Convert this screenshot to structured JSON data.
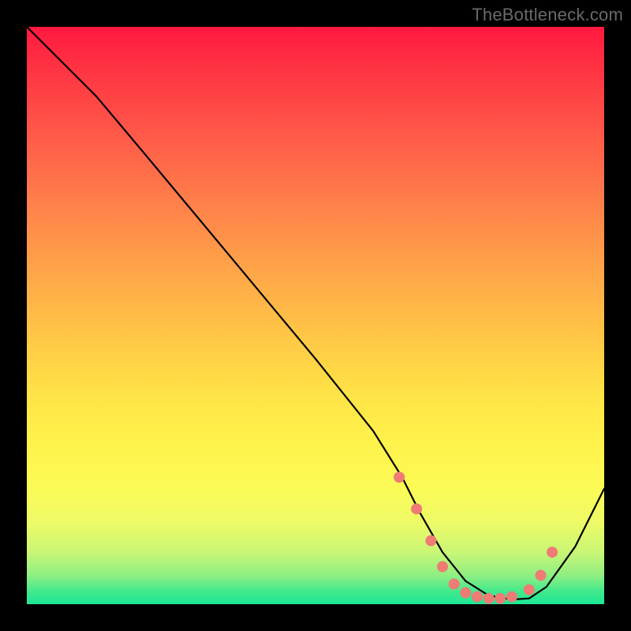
{
  "watermark": "TheBottleneck.com",
  "chart_data": {
    "type": "line",
    "title": "",
    "xlabel": "",
    "ylabel": "",
    "xlim": [
      0,
      100
    ],
    "ylim": [
      0,
      100
    ],
    "grid": false,
    "legend": false,
    "series": [
      {
        "name": "curve",
        "color": "#000000",
        "x": [
          0,
          4,
          8,
          12,
          20,
          30,
          40,
          50,
          60,
          65,
          68,
          72,
          76,
          80,
          84,
          87,
          90,
          95,
          100
        ],
        "y": [
          100,
          96,
          92,
          88,
          78.5,
          66.5,
          54.5,
          42.5,
          30,
          22,
          16,
          9,
          4,
          1.5,
          0.8,
          1,
          3,
          10,
          20
        ]
      }
    ],
    "markers": {
      "name": "dots",
      "color": "#ee7b74",
      "radius": 7,
      "x": [
        64.5,
        67.5,
        70,
        72,
        74,
        76,
        78,
        80,
        82,
        84,
        87,
        89,
        91
      ],
      "y": [
        22,
        16.5,
        11,
        6.5,
        3.5,
        2,
        1.3,
        1,
        1,
        1.3,
        2.5,
        5,
        9
      ]
    },
    "background_gradient": {
      "stops": [
        {
          "pos": 0.0,
          "color": "#ff183f"
        },
        {
          "pos": 0.3,
          "color": "#ff7e4a"
        },
        {
          "pos": 0.64,
          "color": "#ffe447"
        },
        {
          "pos": 0.86,
          "color": "#edfa67"
        },
        {
          "pos": 1.0,
          "color": "#1ee796"
        }
      ]
    }
  }
}
